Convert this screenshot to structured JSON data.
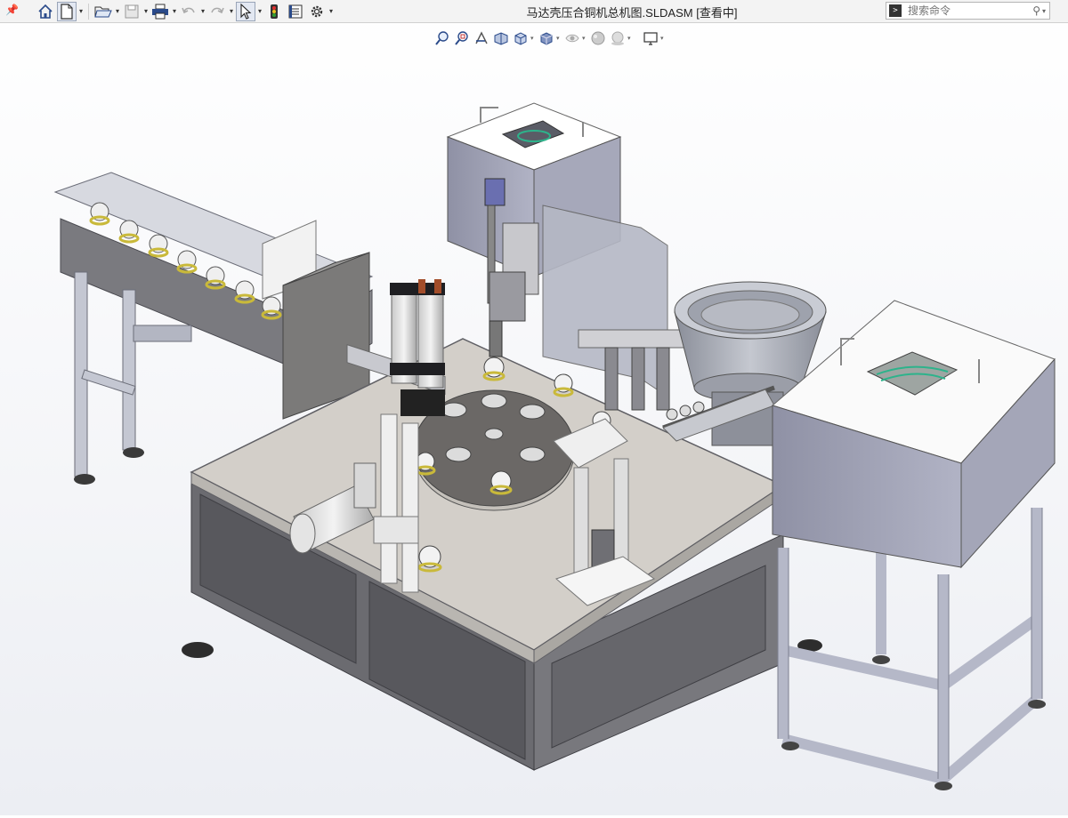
{
  "app": {
    "document_title": "马达壳压合铜机总机图.SLDASM [查看中]"
  },
  "search": {
    "placeholder": "搜索命令"
  },
  "toolbar": {
    "items": [
      "pin-icon",
      "home-icon",
      "new-document-icon",
      "open-icon",
      "save-icon",
      "print-icon",
      "undo-icon",
      "redo-icon",
      "select-icon",
      "rebuild-icon",
      "file-properties-icon",
      "options-icon"
    ]
  },
  "view_toolbar": {
    "items": [
      "zoom-to-fit-icon",
      "zoom-to-area-icon",
      "previous-view-icon",
      "section-view-icon",
      "view-orientation-icon",
      "display-style-icon",
      "hide-show-items-icon",
      "edit-appearance-icon",
      "apply-scene-icon",
      "view-settings-icon"
    ]
  },
  "colors": {
    "frame": "#b9bccb",
    "panel": "#6e6e72",
    "tabletop": "#d2cec8",
    "hopper": "#9ea0b2",
    "accent_yellow": "#c9b93a"
  }
}
